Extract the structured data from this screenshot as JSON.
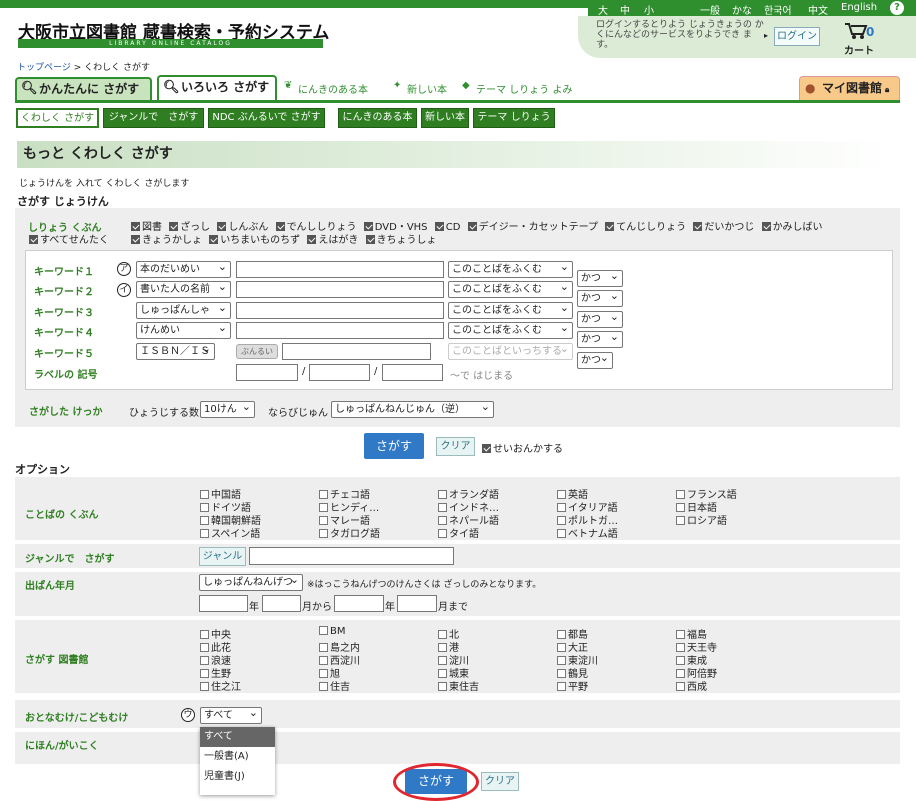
{
  "header": {
    "logo_main": "大阪市立図書館 蔵書検索・予約システム",
    "logo_sub": "LIBRARY ONLINE CATALOG",
    "size_large": "大",
    "size_mid": "中",
    "size_small": "小",
    "lang": [
      "一般",
      "かな",
      "한국어",
      "中文",
      "English"
    ],
    "help": "?",
    "login_msg": "ログインするとりよう じょうきょうの かくにんなどのサービスをりようでき ます。",
    "login_button": "ログイン",
    "cart_label": "カート",
    "cart_count": "0"
  },
  "breadcrumb": {
    "home": "トップページ",
    "sep": " > ",
    "current": "くわしく さがす"
  },
  "tabs": {
    "easy": "かんたんに さがす",
    "various": "いろいろ さがす",
    "popular": "にんきのある本",
    "new": "新しい本",
    "theme": "テーマ しりょう よみ",
    "mylib": "マイ図書館"
  },
  "subtabs": [
    "くわしく さがす",
    "ジャンルで　さがす",
    "NDC ぶんるいで さがす",
    "にんきのある本",
    "新しい本",
    "テーマ しりょう"
  ],
  "page_title": "もっと くわしく さがす",
  "page_desc": "じょうけんを 入れて くわしく さがします",
  "cond_heading": "さがす じょうけん",
  "material": {
    "label": "しりょう くぶん",
    "row1": [
      "図書",
      "ざっし",
      "しんぶん",
      "でんししりょう",
      "DVD・VHS",
      "CD",
      "デイジー・カセットテープ",
      "てんじしりょう",
      "だいかつじ",
      "かみしばい"
    ],
    "row2": [
      "すべてせんたく",
      "きょうかしょ",
      "いちまいものちず",
      "えはがき",
      "きちょうしょ"
    ]
  },
  "keywords": {
    "labels": [
      "キーワード１",
      "キーワード２",
      "キーワード３",
      "キーワード４",
      "キーワード５",
      "ラベルの 記号"
    ],
    "marks": [
      "ア",
      "イ"
    ],
    "fields": [
      "本のだいめい",
      "書いた人の名前",
      "しゅっぱんしゃ",
      "けんめい",
      "ＩＳＢＮ／ＩＳ"
    ],
    "match": [
      "このことばをふくむ",
      "このことばをふくむ",
      "このことばをふくむ",
      "このことばをふくむ",
      "このことばといっちする"
    ],
    "conj": [
      "かつ",
      "かつ",
      "かつ",
      "かつ",
      "かつ"
    ],
    "browse": "ぶんるい",
    "label_hint": "〜で はじまる"
  },
  "result": {
    "label": "さがした けっか",
    "count_label": "ひょうじする数",
    "count": "10けん",
    "order_label": "ならびじゅん",
    "order": "しゅっぱんねんじゅん（逆）"
  },
  "search_button": "さがす",
  "clear_button": "クリア",
  "remember": "せいおんかする",
  "options": {
    "heading": "オプション",
    "lang_label": "ことばの くぶん",
    "langs": [
      "中国語",
      "チェコ語",
      "オランダ語",
      "英語",
      "フランス語",
      "ドイツ語",
      "ヒンディ…",
      "インドネ…",
      "イタリア語",
      "日本語",
      "韓国朝鮮語",
      "マレー語",
      "ネパール語",
      "ポルトガ…",
      "ロシア語",
      "スペイン語",
      "タガログ語",
      "タイ語",
      "ベトナム語"
    ],
    "genre_label": "ジャンルで　さがす",
    "genre_button": "ジャンル",
    "year_label": "出ぱん年月",
    "year_select": "しゅっぱんねんげつ",
    "year_note": "※はっこうねんげつのけんさくは ざっしのみとなります。",
    "year_units": [
      "年",
      "月から",
      "年",
      "月まで"
    ],
    "lib_label": "さがす 図書館",
    "libs": [
      "中央",
      "BM",
      "北",
      "都島",
      "福島",
      "此花",
      "島之内",
      "港",
      "大正",
      "天王寺",
      "浪速",
      "西淀川",
      "淀川",
      "東淀川",
      "東成",
      "生野",
      "旭",
      "城東",
      "鶴見",
      "阿倍野",
      "住之江",
      "住吉",
      "東住吉",
      "平野",
      "西成"
    ],
    "audience_label": "おとなむけ/こどもむけ",
    "audience_mark": "ウ",
    "audience_value": "すべて",
    "audience_options": [
      "すべて",
      "一般書(A)",
      "児童書(J)"
    ],
    "origin_label": "にほん/がいこく"
  },
  "colors": {
    "green": "#2f8f2f",
    "blue": "#2f79c7",
    "highlight": "#e0262e"
  }
}
